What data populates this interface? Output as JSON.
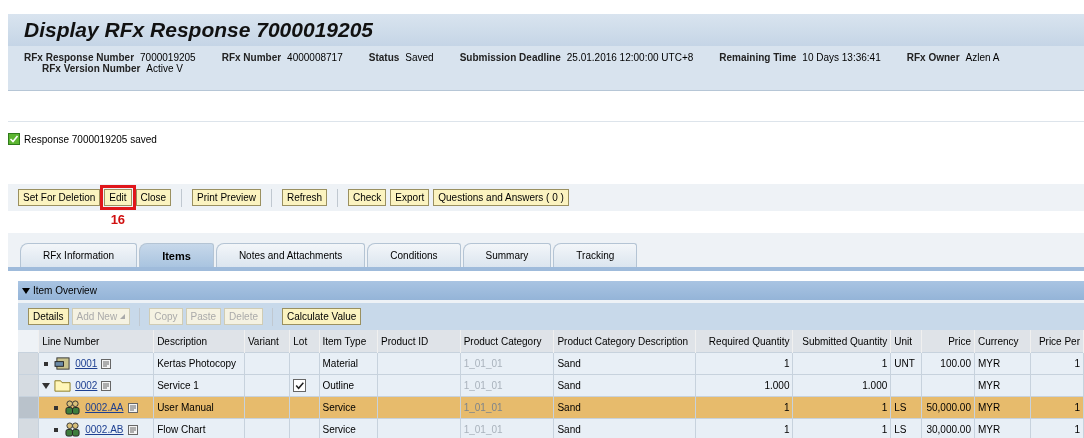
{
  "title": "Display RFx Response 7000019205",
  "header_fields": [
    {
      "label": "RFx Response Number",
      "value": "7000019205",
      "sub_label": "RFx Version Number",
      "sub_value": "Active V"
    },
    {
      "label": "RFx Number",
      "value": "4000008717"
    },
    {
      "label": "Status",
      "value": "Saved"
    },
    {
      "label": "Submission Deadline",
      "value": "25.01.2016 12:00:00 UTC+8"
    },
    {
      "label": "Remaining Time",
      "value": "10 Days 13:36:41"
    },
    {
      "label": "RFx Owner",
      "value": "Azlen A"
    }
  ],
  "message": {
    "text": "Response 7000019205 saved",
    "kind": "success"
  },
  "toolbar": [
    [
      {
        "label": "Set For Deletion"
      },
      {
        "label": "Edit",
        "annotation": "16"
      },
      {
        "label": "Close"
      }
    ],
    [
      {
        "label": "Print Preview"
      }
    ],
    [
      {
        "label": "Refresh"
      }
    ],
    [
      {
        "label": "Check"
      },
      {
        "label": "Export"
      },
      {
        "label": "Questions and Answers ( 0 )"
      }
    ]
  ],
  "tabs": [
    {
      "label": "RFx Information",
      "selected": false
    },
    {
      "label": "Items",
      "selected": true
    },
    {
      "label": "Notes and Attachments",
      "selected": false
    },
    {
      "label": "Conditions",
      "selected": false
    },
    {
      "label": "Summary",
      "selected": false
    },
    {
      "label": "Tracking",
      "selected": false
    }
  ],
  "section": {
    "title": "Item Overview",
    "expanded": true
  },
  "table_toolbar": [
    [
      {
        "label": "Details",
        "disabled": false,
        "dropdown": false
      },
      {
        "label": "Add New",
        "disabled": true,
        "dropdown": true
      }
    ],
    [
      {
        "label": "Copy",
        "disabled": true,
        "dropdown": false
      },
      {
        "label": "Paste",
        "disabled": true,
        "dropdown": false
      },
      {
        "label": "Delete",
        "disabled": true,
        "dropdown": false
      }
    ],
    [
      {
        "label": "Calculate Value",
        "disabled": false,
        "dropdown": false
      }
    ]
  ],
  "columns": [
    "Line Number",
    "Description",
    "Variant",
    "Lot",
    "Item Type",
    "Product ID",
    "Product Category",
    "Product Category Description",
    "Required Quantity",
    "Submitted Quantity",
    "Unit",
    "Price",
    "Currency",
    "Price Per"
  ],
  "rows": [
    {
      "kind": "material",
      "expanded": false,
      "selected": false,
      "line": "0001",
      "description": "Kertas Photocopy",
      "lot": false,
      "item_type": "Material",
      "category": "1_01_01",
      "category_description": "Sand",
      "required": "1",
      "submitted": "1",
      "unit": "UNT",
      "price": "100.00",
      "currency": "MYR",
      "price_per": "1"
    },
    {
      "kind": "outline",
      "expanded": true,
      "selected": false,
      "line": "0002",
      "description": "Service 1",
      "lot": true,
      "item_type": "Outline",
      "category": "1_01_01",
      "category_description": "Sand",
      "required": "1.000",
      "submitted": "1.000",
      "currency": "MYR"
    },
    {
      "kind": "service",
      "expanded": false,
      "selected": true,
      "line": "0002.AA",
      "description": "User Manual",
      "lot": false,
      "item_type": "Service",
      "category": "1_01_01",
      "category_description": "Sand",
      "required": "1",
      "submitted": "1",
      "unit": "LS",
      "price": "50,000.00",
      "currency": "MYR",
      "price_per": "1"
    },
    {
      "kind": "service",
      "expanded": false,
      "selected": false,
      "line": "0002.AB",
      "description": "Flow Chart",
      "lot": false,
      "item_type": "Service",
      "category": "1_01_01",
      "category_description": "Sand",
      "required": "1",
      "submitted": "1",
      "unit": "LS",
      "price": "30,000.00",
      "currency": "MYR",
      "price_per": "1"
    }
  ]
}
